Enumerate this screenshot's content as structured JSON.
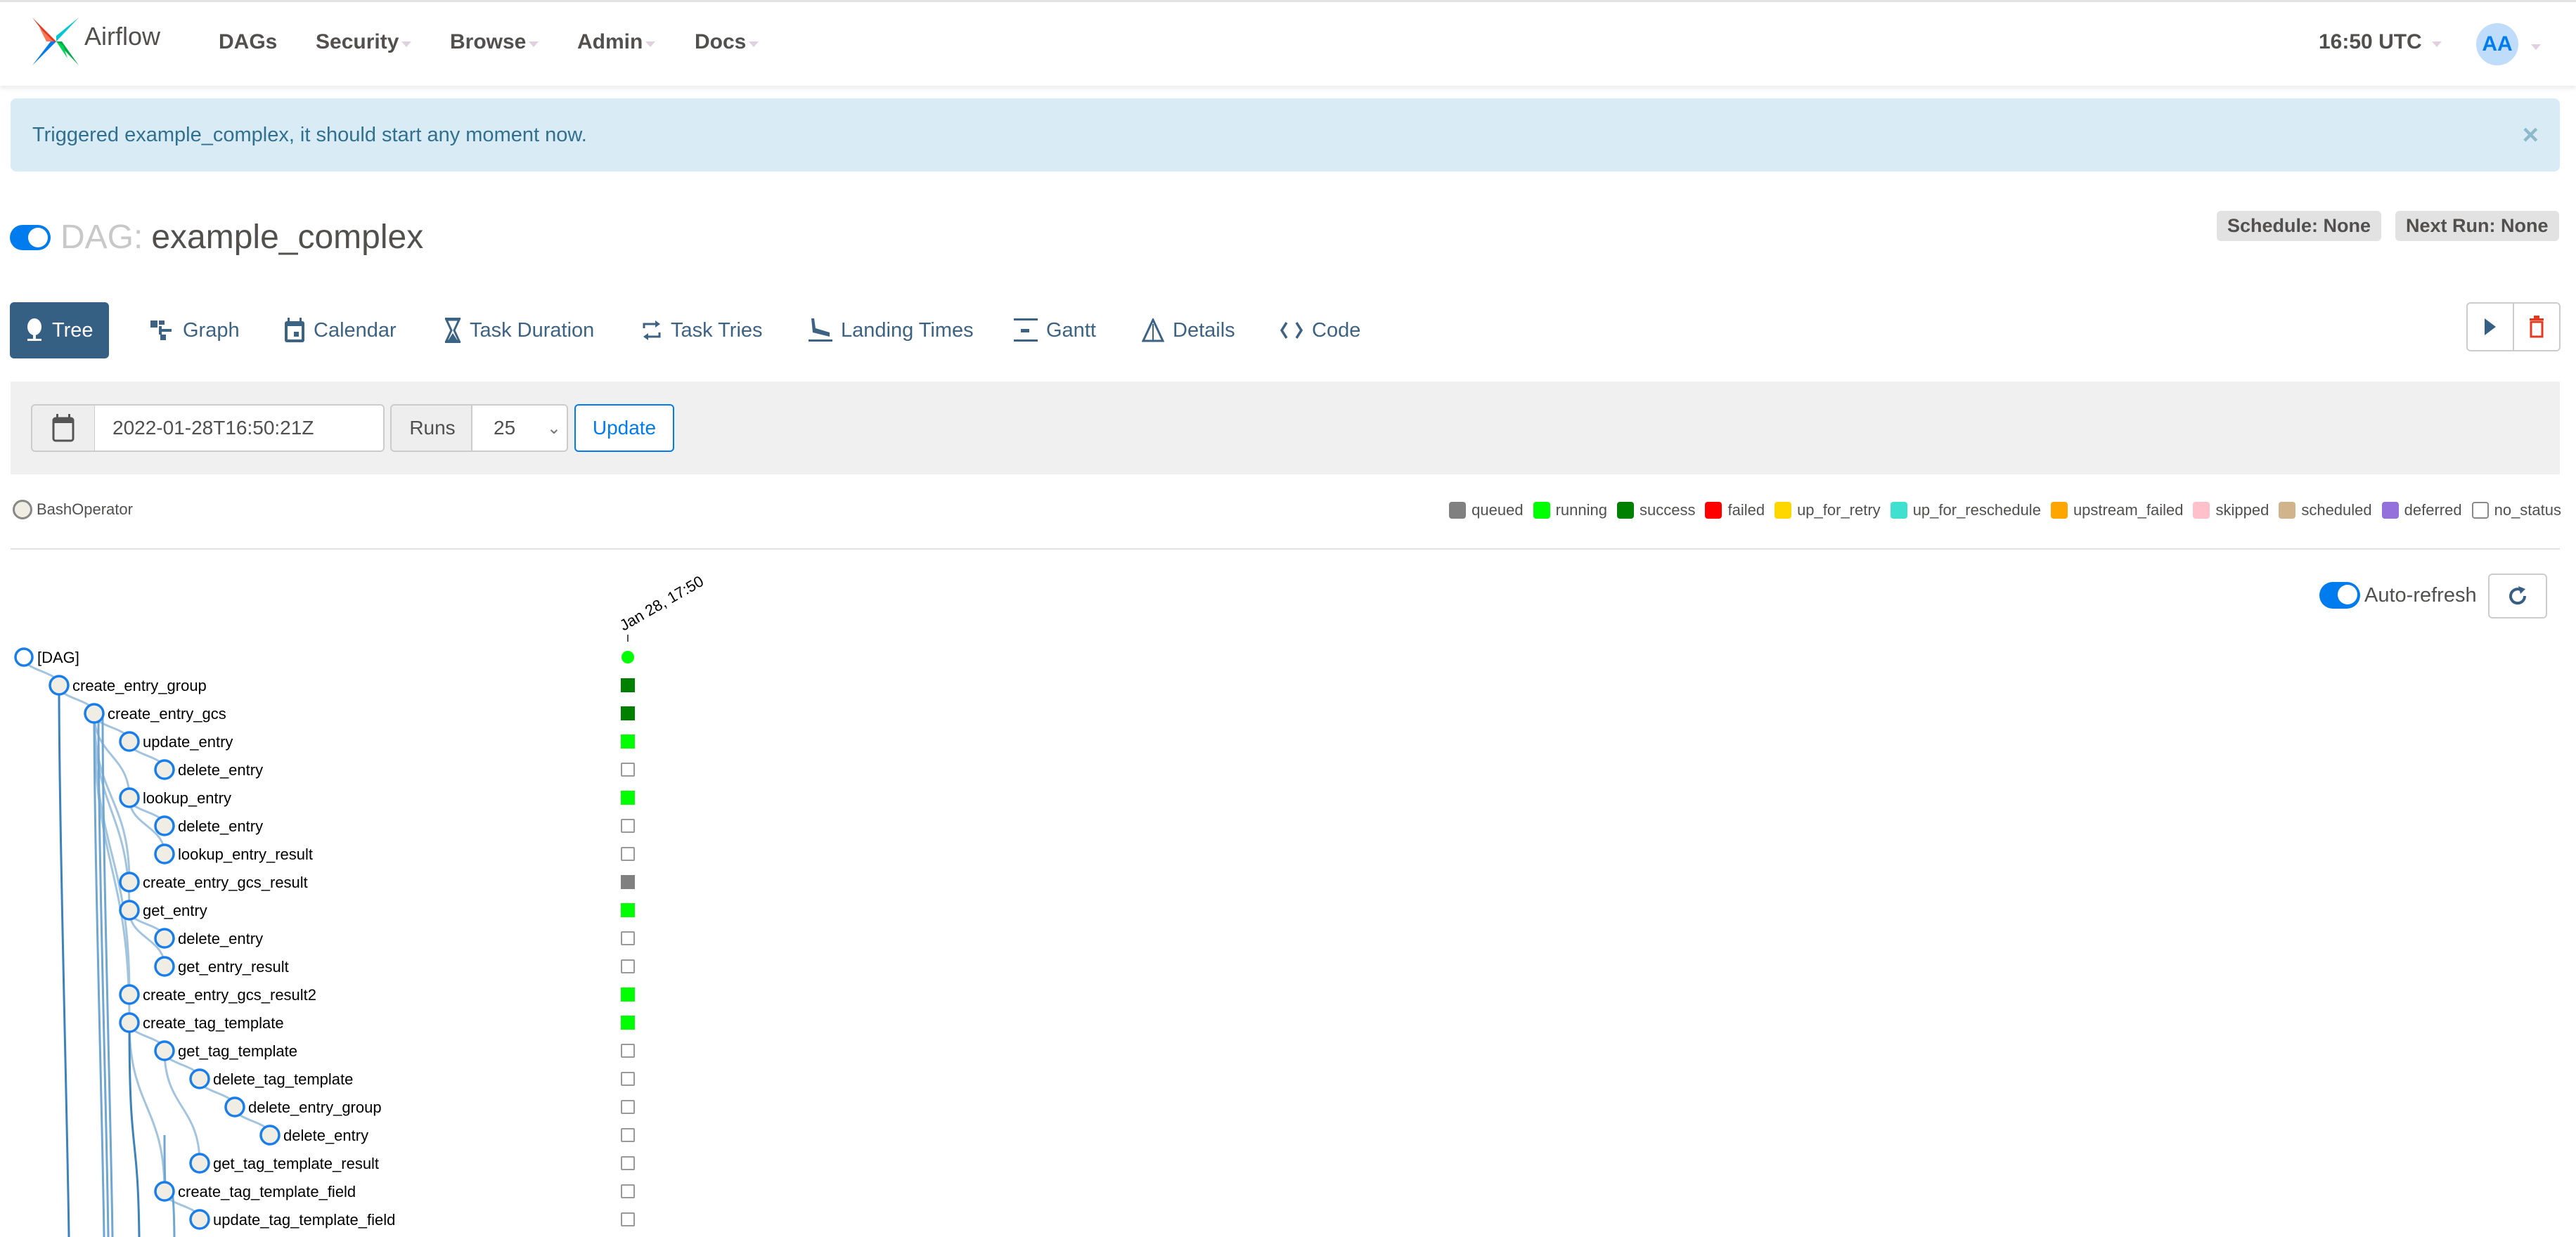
{
  "navbar": {
    "brand": "Airflow",
    "items": [
      {
        "label": "DAGs",
        "dropdown": false
      },
      {
        "label": "Security",
        "dropdown": true
      },
      {
        "label": "Browse",
        "dropdown": true
      },
      {
        "label": "Admin",
        "dropdown": true
      },
      {
        "label": "Docs",
        "dropdown": true
      }
    ],
    "time": "16:50 UTC",
    "user_initials": "AA"
  },
  "alert": {
    "message": "Triggered example_complex, it should start any moment now.",
    "close_icon": "close-icon"
  },
  "dag": {
    "label": "DAG:",
    "name": "example_complex",
    "paused": false,
    "schedule": "Schedule: None",
    "next_run": "Next Run: None"
  },
  "tabs": [
    {
      "label": "Tree",
      "icon": "tree-icon",
      "active": true
    },
    {
      "label": "Graph",
      "icon": "graph-icon",
      "active": false
    },
    {
      "label": "Calendar",
      "icon": "calendar-icon",
      "active": false
    },
    {
      "label": "Task Duration",
      "icon": "hourglass-icon",
      "active": false
    },
    {
      "label": "Task Tries",
      "icon": "repeat-icon",
      "active": false
    },
    {
      "label": "Landing Times",
      "icon": "landing-icon",
      "active": false
    },
    {
      "label": "Gantt",
      "icon": "gantt-icon",
      "active": false
    },
    {
      "label": "Details",
      "icon": "details-icon",
      "active": false
    },
    {
      "label": "Code",
      "icon": "code-icon",
      "active": false
    }
  ],
  "actions": {
    "trigger_icon": "play-icon",
    "delete_icon": "trash-icon"
  },
  "filter": {
    "base_date": "2022-01-28T16:50:21Z",
    "runs_label": "Runs",
    "runs_value": "25",
    "update_label": "Update"
  },
  "operator_legend": [
    {
      "label": "BashOperator",
      "color": "#f0ede4"
    }
  ],
  "state_legend": [
    {
      "label": "queued",
      "color": "#808080"
    },
    {
      "label": "running",
      "color": "#00ff00"
    },
    {
      "label": "success",
      "color": "#008000"
    },
    {
      "label": "failed",
      "color": "#ff0000"
    },
    {
      "label": "up_for_retry",
      "color": "#ffd700"
    },
    {
      "label": "up_for_reschedule",
      "color": "#40e0d0"
    },
    {
      "label": "upstream_failed",
      "color": "#ffa500"
    },
    {
      "label": "skipped",
      "color": "#ffc0cb"
    },
    {
      "label": "scheduled",
      "color": "#d2b48c"
    },
    {
      "label": "deferred",
      "color": "#9370db"
    },
    {
      "label": "no_status",
      "color": "#ffffff"
    }
  ],
  "auto_refresh": {
    "label": "Auto-refresh",
    "enabled": true
  },
  "tree": {
    "run_label": "Jan 28, 17:50",
    "dag_run_state": "running",
    "nodes": [
      {
        "label": "[DAG]",
        "depth": 0,
        "state": "running",
        "is_dag": true
      },
      {
        "label": "create_entry_group",
        "depth": 1,
        "state": "success"
      },
      {
        "label": "create_entry_gcs",
        "depth": 2,
        "state": "success"
      },
      {
        "label": "update_entry",
        "depth": 3,
        "state": "running"
      },
      {
        "label": "delete_entry",
        "depth": 4,
        "state": "no_status"
      },
      {
        "label": "lookup_entry",
        "depth": 3,
        "state": "running"
      },
      {
        "label": "delete_entry",
        "depth": 4,
        "state": "no_status"
      },
      {
        "label": "lookup_entry_result",
        "depth": 4,
        "state": "no_status"
      },
      {
        "label": "create_entry_gcs_result",
        "depth": 3,
        "state": "queued"
      },
      {
        "label": "get_entry",
        "depth": 3,
        "state": "running"
      },
      {
        "label": "delete_entry",
        "depth": 4,
        "state": "no_status"
      },
      {
        "label": "get_entry_result",
        "depth": 4,
        "state": "no_status"
      },
      {
        "label": "create_entry_gcs_result2",
        "depth": 3,
        "state": "running"
      },
      {
        "label": "create_tag_template",
        "depth": 3,
        "state": "running"
      },
      {
        "label": "get_tag_template",
        "depth": 4,
        "state": "no_status"
      },
      {
        "label": "delete_tag_template",
        "depth": 5,
        "state": "no_status"
      },
      {
        "label": "delete_entry_group",
        "depth": 6,
        "state": "no_status"
      },
      {
        "label": "delete_entry",
        "depth": 7,
        "state": "no_status"
      },
      {
        "label": "get_tag_template_result",
        "depth": 5,
        "state": "no_status"
      },
      {
        "label": "create_tag_template_field",
        "depth": 4,
        "state": "no_status"
      },
      {
        "label": "update_tag_template_field",
        "depth": 5,
        "state": "no_status"
      }
    ]
  }
}
